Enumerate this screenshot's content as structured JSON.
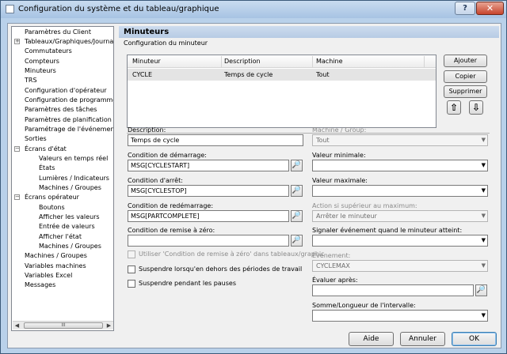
{
  "window": {
    "title": "Configuration du système et du tableau/graphique",
    "help_label": "?",
    "close_label": "✕"
  },
  "tree": {
    "items": [
      "Paramètres du Client",
      "Tableaux/Graphiques/Journa",
      "Commutateurs",
      "Compteurs",
      "Minuteurs",
      "TRS",
      "Configuration d'opérateur",
      "Configuration de programme",
      "Paramètres des tâches",
      "Paramètres de planification",
      "Paramétrage de l'événement",
      "Sorties",
      "Écrans d'état",
      "Valeurs en temps réel",
      "États",
      "Lumières / Indicateurs",
      "Machines / Groupes",
      "Écrans opérateur",
      "Boutons",
      "Afficher les valeurs",
      "Entrée de valeurs",
      "Afficher l'état",
      "Machines / Groupes",
      "Machines / Groupes",
      "Variables machines",
      "Variables Excel",
      "Messages"
    ],
    "expander_plus": "+",
    "expander_minus": "−",
    "scroll_left": "◀",
    "scroll_right": "▶",
    "scroll_grip": "III"
  },
  "header": {
    "title": "Minuteurs",
    "subtitle": "Configuration du minuteur"
  },
  "grid": {
    "columns": [
      "Minuteur",
      "Description",
      "Machine"
    ],
    "rows": [
      {
        "minuteur": "CYCLE",
        "description": "Temps de cycle",
        "machine": "Tout"
      }
    ]
  },
  "side_buttons": {
    "add": "Ajouter",
    "copy": "Copier",
    "delete": "Supprimer",
    "up": "⇧",
    "down": "⇩"
  },
  "form": {
    "description_label": "Description:",
    "description_value": "Temps de cycle",
    "start_label": "Condition de démarrage:",
    "start_value": "MSG[CYCLESTART]",
    "stop_label": "Condition d'arrêt:",
    "stop_value": "MSG[CYCLESTOP]",
    "restart_label": "Condition de redémarrage:",
    "restart_value": "MSG[PARTCOMPLETE]",
    "reset_label": "Condition de remise à zéro:",
    "reset_value": "",
    "use_reset_label": "Utiliser 'Condition de remise à zéro' dans tableaux/graphic",
    "suspend_outside_label": "Suspendre lorsqu'en dehors des périodes de travail",
    "suspend_breaks_label": "Suspendre pendant les pauses",
    "machine_group_label": "Machine / Group:",
    "machine_group_value": "Tout",
    "min_label": "Valeur minimale:",
    "min_value": "",
    "max_label": "Valeur maximale:",
    "max_value": "",
    "action_label": "Action si supérieur au maximum:",
    "action_value": "Arrêter le minuteur",
    "signal_label": "Signaler événement quand le minuteur atteint:",
    "signal_value": "",
    "event_label": "Événement:",
    "event_value": "CYCLEMAX",
    "evaluate_label": "Évaluer après:",
    "evaluate_value": "",
    "sum_label": "Somme/Longueur de l'intervalle:",
    "sum_value": "",
    "picker_glyph": "🔎",
    "dropdown_glyph": "▼"
  },
  "footer": {
    "help": "Aide",
    "cancel": "Annuler",
    "ok": "OK"
  }
}
